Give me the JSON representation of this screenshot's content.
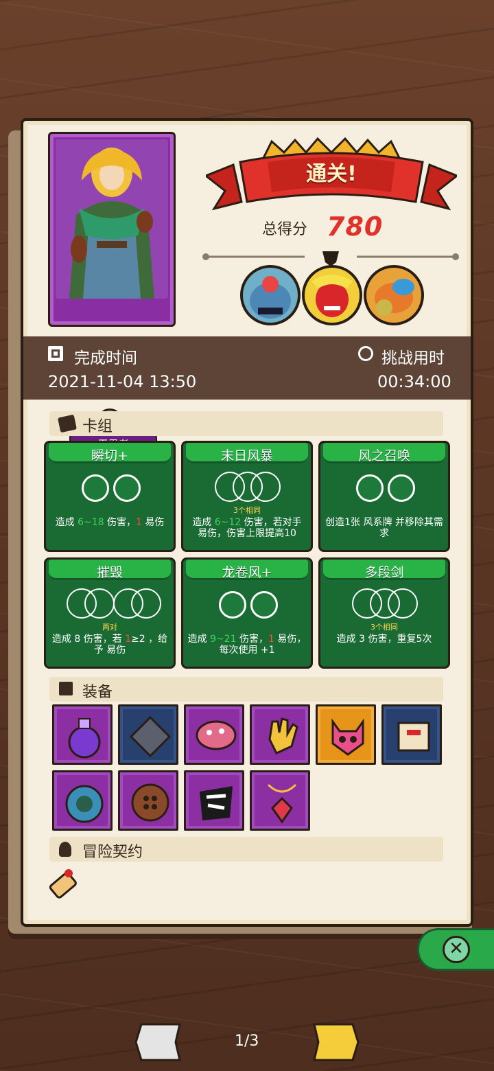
{
  "hero": {
    "name": "无畏者"
  },
  "result": {
    "banner": "通关!",
    "score_label": "总得分",
    "score_value": "780"
  },
  "times": {
    "complete_label": "完成时间",
    "complete_value": "2021-11-04 13:50",
    "challenge_label": "挑战用时",
    "challenge_value": "00:34:00"
  },
  "sections": {
    "deck": "卡组",
    "equipment": "装备",
    "contract": "冒险契约"
  },
  "cards": [
    {
      "title": "瞬切+",
      "sub": "",
      "d1": "造成 ",
      "d2": "6~18",
      "d3": " 伤害，",
      "d4": "1",
      "d5": " 易伤"
    },
    {
      "title": "末日风暴",
      "sub": "3个相同",
      "d1": "造成 ",
      "d2": "6~12",
      "d3": " 伤害，若对手 ",
      "d4": "",
      "d5": "易伤，伤害上限提高10"
    },
    {
      "title": "风之召唤",
      "sub": "",
      "d1": "创造1张 ",
      "d2": "",
      "d3": "风系牌 并移除其需求",
      "d4": "",
      "d5": ""
    },
    {
      "title": "摧毁",
      "sub": "两对",
      "d1": "造成 ",
      "d2": "",
      "d3": "8 伤害，若 ",
      "d4": "1",
      "d5": "≥2 ，给予 易伤"
    },
    {
      "title": "龙卷风+",
      "sub": "",
      "d1": "造成 ",
      "d2": "9~21",
      "d3": " 伤害，",
      "d4": "1",
      "d5": " 易伤，每次使用 +1"
    },
    {
      "title": "多段剑",
      "sub": "3个相同",
      "d1": "造成 ",
      "d2": "",
      "d3": "3 伤害，重复5次",
      "d4": "",
      "d5": ""
    }
  ],
  "equipment_icons": [
    "potion-icon",
    "diamond-gem-icon",
    "mushroom-icon",
    "glove-icon",
    "demon-mask-icon",
    "scroll-icon",
    "ornate-shield-icon",
    "button-icon",
    "rune-icon",
    "ruby-pendant-icon"
  ],
  "pager": {
    "text": "1/3"
  },
  "colors": {
    "accent_red": "#e0322b",
    "card_green": "#196b33",
    "panel": "#f6efdf"
  }
}
